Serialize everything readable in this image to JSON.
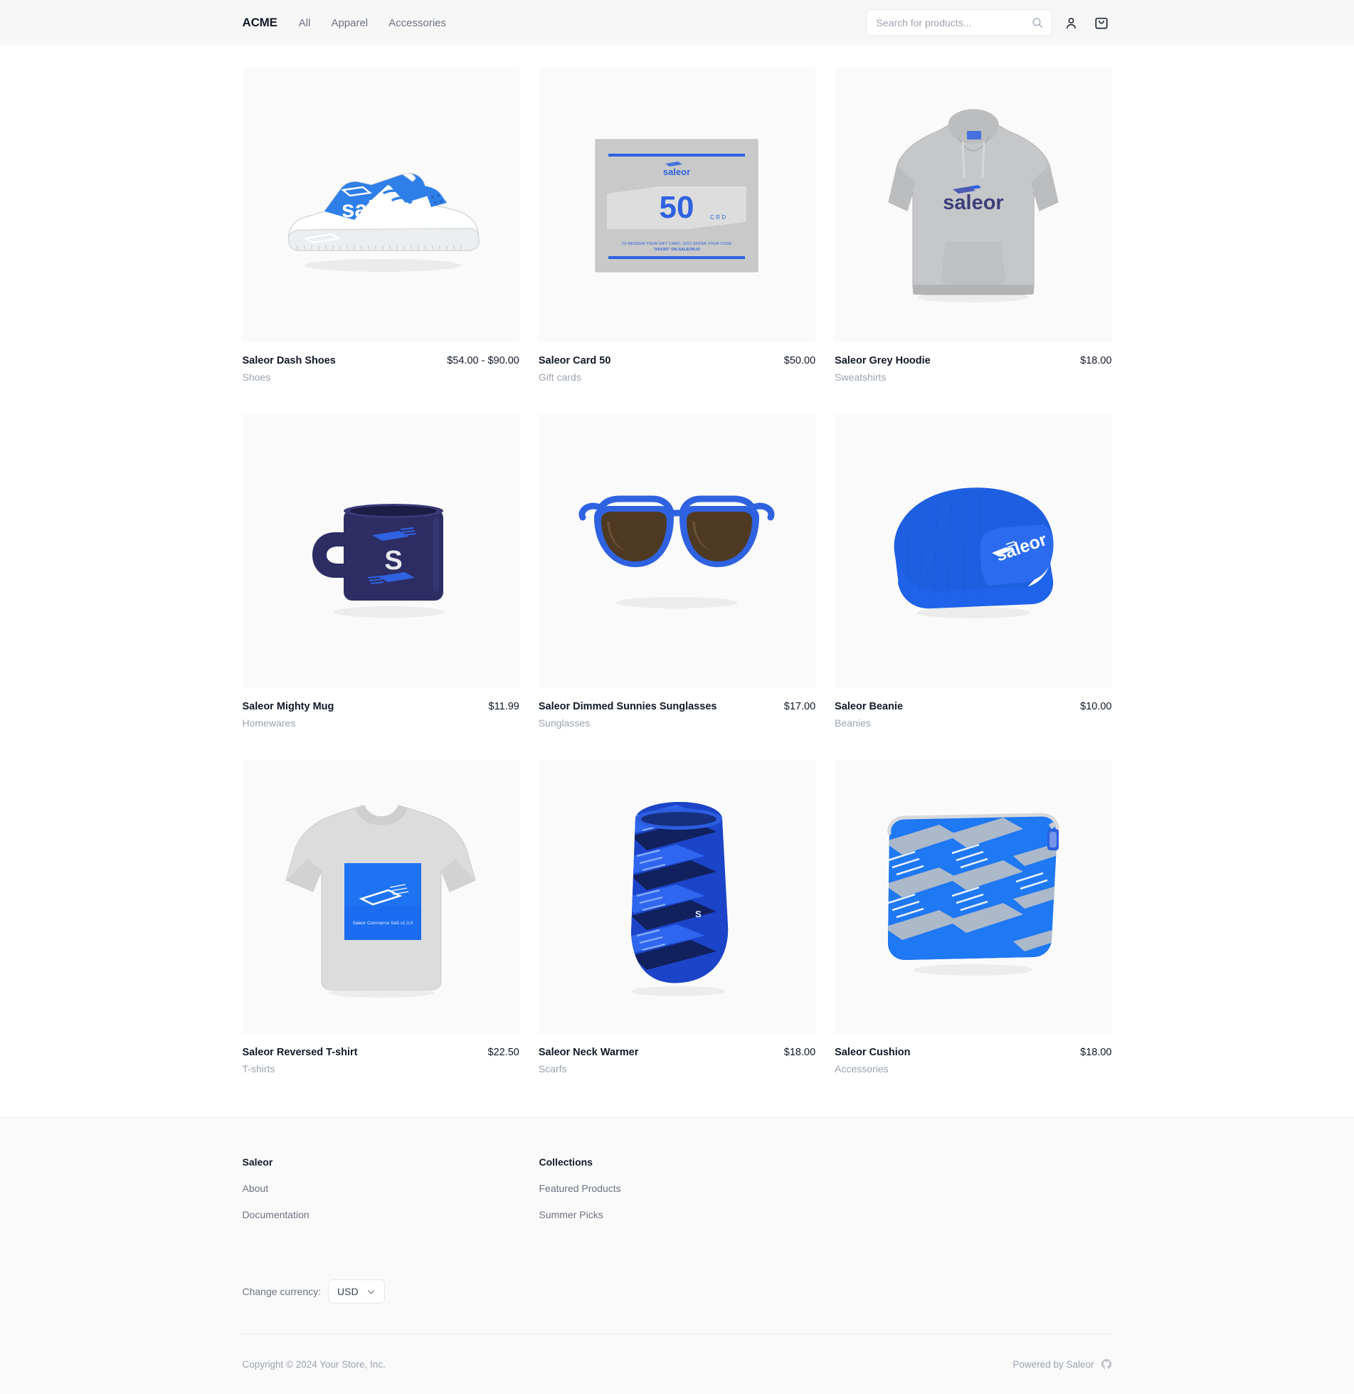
{
  "header": {
    "brand": "ACME",
    "nav": [
      {
        "label": "All"
      },
      {
        "label": "Apparel"
      },
      {
        "label": "Accessories"
      }
    ],
    "search": {
      "placeholder": "Search for products...",
      "value": ""
    },
    "icons": {
      "search": "search-icon",
      "account": "user-icon",
      "cart": "shopping-bag-icon"
    }
  },
  "products": [
    {
      "name": "Saleor Dash Shoes",
      "price": "$54.00 - $90.00",
      "category": "Shoes",
      "image": "sneaker"
    },
    {
      "name": "Saleor Card 50",
      "price": "$50.00",
      "category": "Gift cards",
      "image": "giftcard"
    },
    {
      "name": "Saleor Grey Hoodie",
      "price": "$18.00",
      "category": "Sweatshirts",
      "image": "hoodie"
    },
    {
      "name": "Saleor Mighty Mug",
      "price": "$11.99",
      "category": "Homewares",
      "image": "mug"
    },
    {
      "name": "Saleor Dimmed Sunnies Sunglasses",
      "price": "$17.00",
      "category": "Sunglasses",
      "image": "sunglasses"
    },
    {
      "name": "Saleor Beanie",
      "price": "$10.00",
      "category": "Beanies",
      "image": "beanie"
    },
    {
      "name": "Saleor Reversed T-shirt",
      "price": "$22.50",
      "category": "T-shirts",
      "image": "tshirt"
    },
    {
      "name": "Saleor Neck Warmer",
      "price": "$18.00",
      "category": "Scarfs",
      "image": "neckwarmer"
    },
    {
      "name": "Saleor Cushion",
      "price": "$18.00",
      "category": "Accessories",
      "image": "cushion"
    }
  ],
  "product_art": {
    "giftcard_amount": "50",
    "giftcard_currency": "CRD",
    "giftcard_brand": "saleor",
    "giftcard_note_line1": "TO REDEEM YOUR GIFT CARD, JUST ENTER YOUR CODE",
    "giftcard_note_line2": "\"XXXXX\" ON SALEOR.IO",
    "sneaker_brand": "saleor",
    "hoodie_brand": "saleor",
    "beanie_brand": "saleor",
    "mug_letter": "S",
    "tshirt_caption": "Saleor Commerce SaS v1.0.0"
  },
  "footer": {
    "columns": [
      {
        "title": "Saleor",
        "links": [
          {
            "label": "About"
          },
          {
            "label": "Documentation"
          }
        ]
      },
      {
        "title": "Collections",
        "links": [
          {
            "label": "Featured Products"
          },
          {
            "label": "Summer Picks"
          }
        ]
      }
    ],
    "currency": {
      "label": "Change currency:",
      "value": "USD"
    },
    "copyright": "Copyright © 2024 Your Store, Inc.",
    "powered_by": "Powered by Saleor"
  },
  "colors": {
    "brand_blue": "#2563eb",
    "bright_blue": "#1d5fe0",
    "navy": "#2d2d64",
    "grey_tile": "#fafafa",
    "header_bg": "#f7f7f7",
    "text_primary": "#111827",
    "text_muted": "#9ca3af"
  }
}
